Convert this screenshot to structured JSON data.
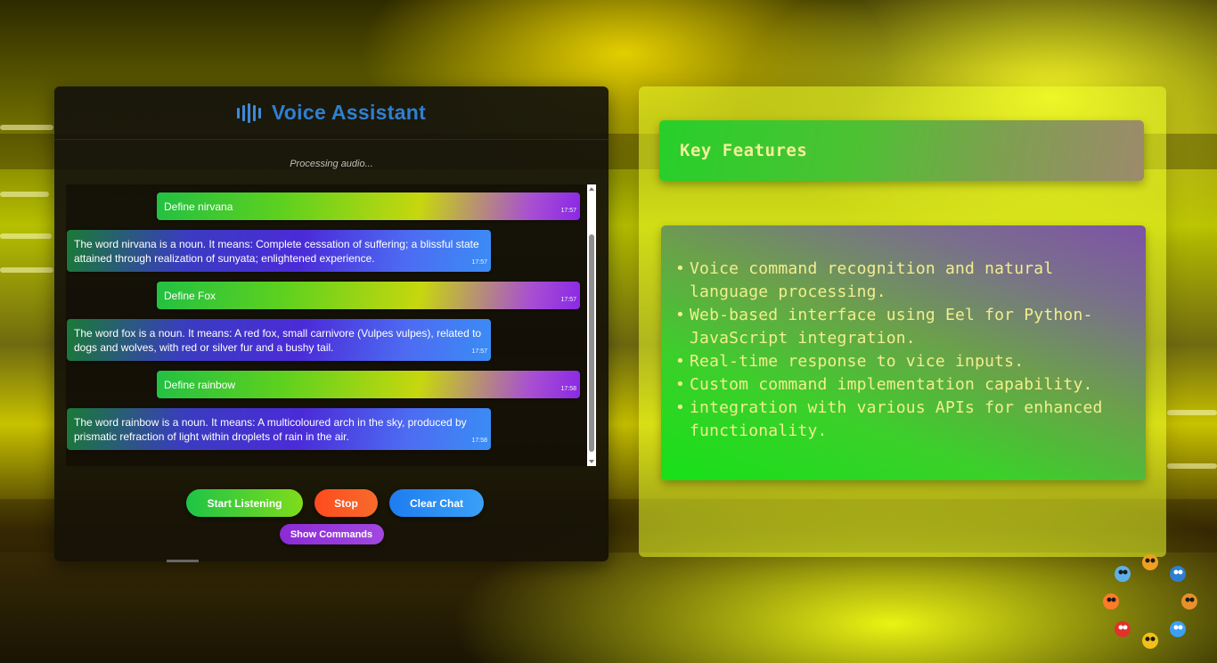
{
  "app": {
    "title": "Voice Assistant",
    "status": "Processing audio..."
  },
  "messages": [
    {
      "role": "user",
      "text": "Define nirvana",
      "time": "17:57"
    },
    {
      "role": "bot",
      "text": "The word nirvana is a noun. It means: Complete cessation of suffering; a blissful state attained through realization of sunyata; enlightened experience.",
      "time": "17:57"
    },
    {
      "role": "user",
      "text": "Define Fox",
      "time": "17:57"
    },
    {
      "role": "bot",
      "text": "The word fox is a noun. It means: A red fox, small carnivore (Vulpes vulpes), related to dogs and wolves, with red or silver fur and a bushy tail.",
      "time": "17:57"
    },
    {
      "role": "user",
      "text": "Define rainbow",
      "time": "17:58"
    },
    {
      "role": "bot",
      "text": "The word rainbow is a noun. It means: A multicoloured arch in the sky, produced by prismatic refraction of light within droplets of rain in the air.",
      "time": "17:58"
    }
  ],
  "controls": {
    "start_label": "Start Listening",
    "stop_label": "Stop",
    "clear_label": "Clear Chat",
    "commands_label": "Show Commands"
  },
  "features": {
    "title": "Key Features",
    "items": [
      "Voice command recognition and natural language processing.",
      "Web-based interface using Eel for Python-JavaScript integration.",
      "Real-time response to vice inputs.",
      "Custom command implementation capability.",
      "integration with various APIs for enhanced functionality."
    ]
  },
  "colors": {
    "title_blue": "#2f7fd0",
    "feature_text": "#f3ee8e",
    "start_green": "#1ec447",
    "stop_orange": "#ff4b1e",
    "clear_blue": "#1e7df0",
    "commands_purple": "#8a2bd5"
  },
  "icons": {
    "title_icon": "sound-wave-icon",
    "logo": "robots-circle-logo"
  }
}
